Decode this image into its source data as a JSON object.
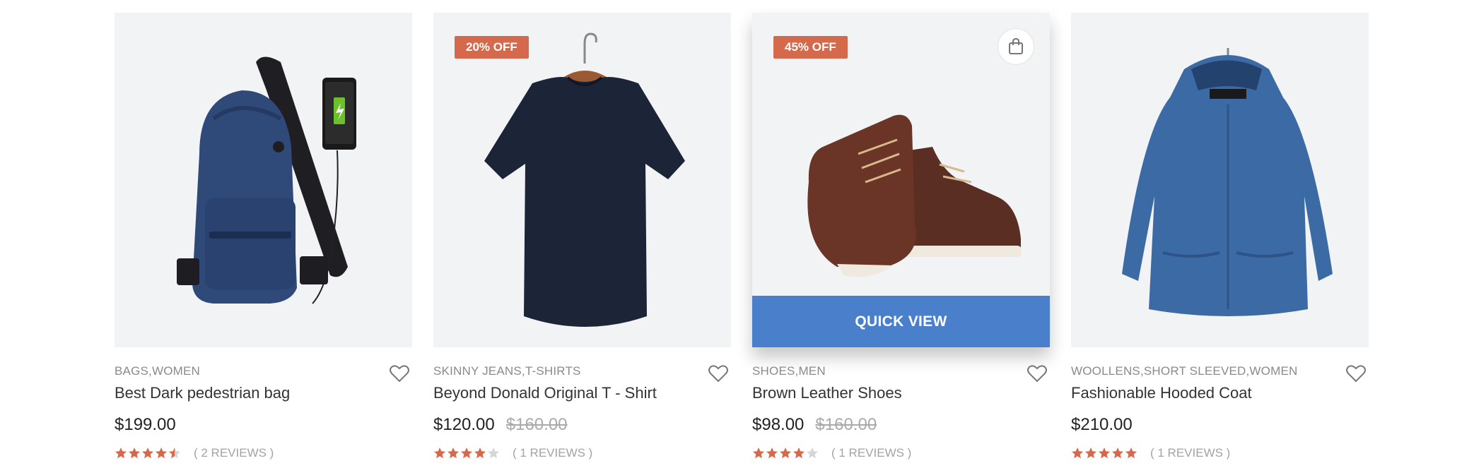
{
  "products": [
    {
      "categories": "BAGS,WOMEN",
      "title": "Best Dark pedestrian bag",
      "price": "$199.00",
      "old_price": "",
      "badge": "",
      "rating": 4.5,
      "reviews": "( 2 REVIEWS )",
      "image_icon": "crossbody-backpack-image"
    },
    {
      "categories": "SKINNY JEANS,T-SHIRTS",
      "title": "Beyond Donald Original T - Shirt",
      "price": "$120.00",
      "old_price": "$160.00",
      "badge": "20% OFF",
      "rating": 4,
      "reviews": "( 1 REVIEWS )",
      "image_icon": "tshirt-on-hanger-image"
    },
    {
      "categories": "SHOES,MEN",
      "title": "Brown Leather Shoes",
      "price": "$98.00",
      "old_price": "$160.00",
      "badge": "45% OFF",
      "rating": 4,
      "reviews": "( 1 REVIEWS )",
      "image_icon": "brown-boots-image",
      "quick_view_label": "QUICK VIEW"
    },
    {
      "categories": "WOOLLENS,SHORT SLEEVED,WOMEN",
      "title": "Fashionable Hooded Coat",
      "price": "$210.00",
      "old_price": "",
      "badge": "",
      "rating": 5,
      "reviews": "( 1 REVIEWS )",
      "image_icon": "hooded-coat-image"
    }
  ],
  "colors": {
    "badge": "#d4694b",
    "star": "#d4694b",
    "star_empty": "#d6d6d6",
    "quick_view": "#4a7fcb"
  }
}
